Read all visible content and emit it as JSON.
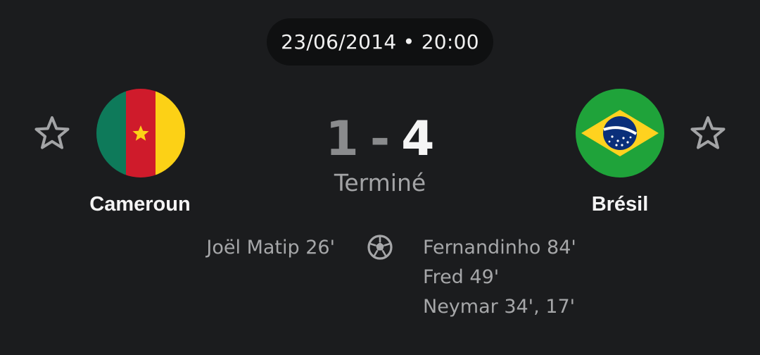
{
  "match": {
    "datetime": "23/06/2014 • 20:00",
    "status": "Terminé",
    "score": {
      "home": "1",
      "separator": "-",
      "away": "4"
    }
  },
  "home_team": {
    "name": "Cameroun",
    "flag_icon": "cameroon-flag-icon",
    "scorers": [
      "Joël Matip 26'"
    ]
  },
  "away_team": {
    "name": "Brésil",
    "flag_icon": "brazil-flag-icon",
    "scorers": [
      "Fernandinho 84'",
      "Fred 49'",
      "Neymar 34', 17'"
    ]
  },
  "icons": {
    "favorite": "star-outline-icon",
    "goal": "soccer-ball-icon"
  },
  "colors": {
    "background": "#1b1c1e",
    "pill": "#0f1011",
    "score_winner": "#f5f5f5",
    "score_loser": "#8a8b8d",
    "muted_text": "#a6a7a9"
  }
}
